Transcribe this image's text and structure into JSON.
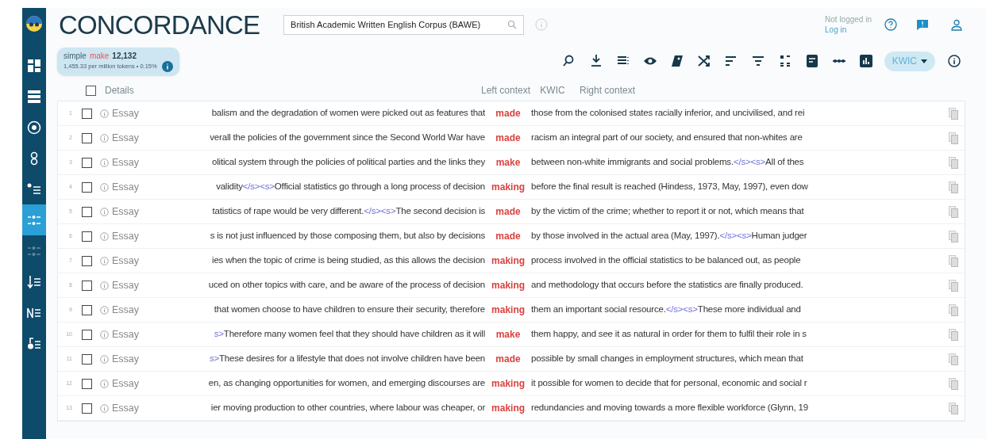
{
  "app": {
    "title": "CONCORDANCE",
    "corpus": "British Academic Written English Corpus (BAWE)",
    "login_status": "Not logged in",
    "login_link": "Log in"
  },
  "sidebar": {
    "items": [
      {
        "selected": false,
        "disabled": false
      },
      {
        "selected": false,
        "disabled": false
      },
      {
        "selected": false,
        "disabled": false
      },
      {
        "selected": false,
        "disabled": false
      },
      {
        "selected": false,
        "disabled": false
      },
      {
        "selected": true,
        "disabled": false
      },
      {
        "selected": false,
        "disabled": true
      },
      {
        "selected": false,
        "disabled": false
      },
      {
        "selected": false,
        "disabled": false
      },
      {
        "selected": false,
        "disabled": false
      }
    ]
  },
  "result": {
    "query_type": "simple",
    "query": "make",
    "hits": "12,132",
    "frequency": "1,455.33 per million tokens • 0.15%"
  },
  "view_mode": "KWIC",
  "table": {
    "select_all": false,
    "columns": [
      "Details",
      "Left context",
      "KWIC",
      "Right context"
    ],
    "rows": [
      {
        "number": "1",
        "checked": false,
        "source": "Essay",
        "left": [
          {
            "kind": "text",
            "text": "balism and the degradation of women were picked out as features that"
          }
        ],
        "kwic": "made",
        "right": [
          {
            "kind": "text",
            "text": "those from the colonised states racially inferior, and uncivilised, and rei"
          }
        ]
      },
      {
        "number": "2",
        "checked": false,
        "source": "Essay",
        "left": [
          {
            "kind": "text",
            "text": "verall the policies of the government since the Second World War have"
          }
        ],
        "kwic": "made",
        "right": [
          {
            "kind": "text",
            "text": "racism an integral part of our society, and ensured that non-whites are"
          }
        ]
      },
      {
        "number": "3",
        "checked": false,
        "source": "Essay",
        "left": [
          {
            "kind": "text",
            "text": "olitical system through the policies of political parties and the links they"
          }
        ],
        "kwic": "make",
        "right": [
          {
            "kind": "text",
            "text": "between non-white immigrants and social problems."
          },
          {
            "kind": "tag",
            "text": "</s><s>"
          },
          {
            "kind": "text",
            "text": "All of thes"
          }
        ]
      },
      {
        "number": "4",
        "checked": false,
        "source": "Essay",
        "left": [
          {
            "kind": "text",
            "text": "validity"
          },
          {
            "kind": "tag",
            "text": "</s><s>"
          },
          {
            "kind": "text",
            "text": "Official statistics go through a long process of decision"
          }
        ],
        "kwic": "making",
        "right": [
          {
            "kind": "text",
            "text": "before the final result is reached (Hindess, 1973, May, 1997), even dow"
          }
        ]
      },
      {
        "number": "5",
        "checked": false,
        "source": "Essay",
        "left": [
          {
            "kind": "text",
            "text": "tatistics of rape would be very different."
          },
          {
            "kind": "tag",
            "text": "</s><s>"
          },
          {
            "kind": "text",
            "text": "The second decision is"
          }
        ],
        "kwic": "made",
        "right": [
          {
            "kind": "text",
            "text": "by the victim of the crime; whether to report it or not, which means that"
          }
        ]
      },
      {
        "number": "6",
        "checked": false,
        "source": "Essay",
        "left": [
          {
            "kind": "text",
            "text": "s is not just influenced by those composing them, but also by decisions"
          }
        ],
        "kwic": "made",
        "right": [
          {
            "kind": "text",
            "text": "by those involved in the actual area (May, 1997)."
          },
          {
            "kind": "tag",
            "text": "</s><s>"
          },
          {
            "kind": "text",
            "text": "Human judger"
          }
        ]
      },
      {
        "number": "7",
        "checked": false,
        "source": "Essay",
        "left": [
          {
            "kind": "text",
            "text": "ies when the topic of crime is being studied, as this allows the decision"
          }
        ],
        "kwic": "making",
        "right": [
          {
            "kind": "text",
            "text": "process involved in the official statistics to be balanced out, as people"
          }
        ]
      },
      {
        "number": "8",
        "checked": false,
        "source": "Essay",
        "left": [
          {
            "kind": "text",
            "text": "uced on other topics with care, and be aware of the process of decision"
          }
        ],
        "kwic": "making",
        "right": [
          {
            "kind": "text",
            "text": "and methodology that occurs before the statistics are finally produced."
          }
        ]
      },
      {
        "number": "9",
        "checked": false,
        "source": "Essay",
        "left": [
          {
            "kind": "text",
            "text": "that women choose to have children to ensure their security, therefore"
          }
        ],
        "kwic": "making",
        "right": [
          {
            "kind": "text",
            "text": "them an important social resource."
          },
          {
            "kind": "tag",
            "text": "</s><s>"
          },
          {
            "kind": "text",
            "text": "These more individual and"
          }
        ]
      },
      {
        "number": "10",
        "checked": false,
        "source": "Essay",
        "left": [
          {
            "kind": "tag",
            "text": "s>"
          },
          {
            "kind": "text",
            "text": "Therefore many women feel that they should have children as it will"
          }
        ],
        "kwic": "make",
        "right": [
          {
            "kind": "text",
            "text": "them happy, and see it as natural in order for them to fulfil their role in s"
          }
        ]
      },
      {
        "number": "11",
        "checked": false,
        "source": "Essay",
        "left": [
          {
            "kind": "tag",
            "text": "s>"
          },
          {
            "kind": "text",
            "text": "These desires for a lifestyle that does not involve children have been"
          }
        ],
        "kwic": "made",
        "right": [
          {
            "kind": "text",
            "text": "possible by small changes in employment structures, which mean that"
          }
        ]
      },
      {
        "number": "12",
        "checked": false,
        "source": "Essay",
        "left": [
          {
            "kind": "text",
            "text": "en, as changing opportunities for women, and emerging discourses are"
          }
        ],
        "kwic": "making",
        "right": [
          {
            "kind": "text",
            "text": "it possible for women to decide that for personal, economic and social r"
          }
        ]
      },
      {
        "number": "13",
        "checked": false,
        "source": "Essay",
        "left": [
          {
            "kind": "text",
            "text": "ier moving production to other countries, where labour was cheaper, or"
          }
        ],
        "kwic": "making",
        "right": [
          {
            "kind": "text",
            "text": "redundancies and moving towards a more flexible workforce (Glynn, 19"
          }
        ]
      }
    ]
  }
}
